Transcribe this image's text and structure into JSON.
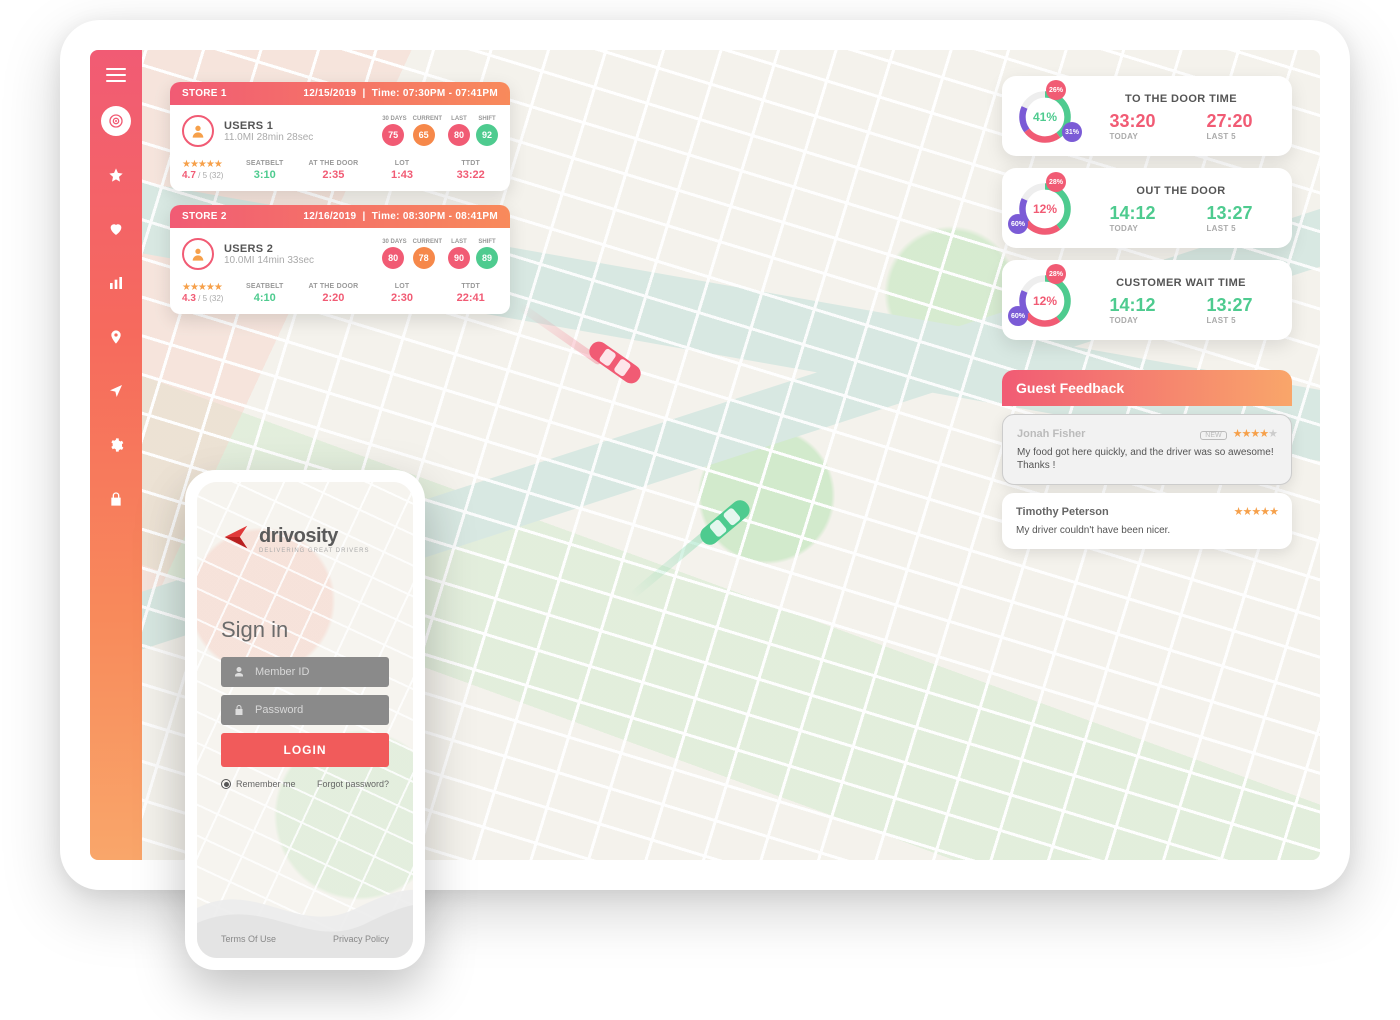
{
  "brand": {
    "name": "drivosity",
    "tagline": "DELIVERING GREAT DRIVERS"
  },
  "colors": {
    "pink": "#f15b74",
    "orange": "#f88a5b",
    "green": "#4ecb8f",
    "purple": "#7b5bd6"
  },
  "sidebar": {
    "items": [
      "menu",
      "target",
      "star",
      "heart",
      "chart",
      "pin",
      "nav",
      "gear",
      "lock"
    ],
    "active_index": 1
  },
  "store_cards": [
    {
      "store": "STORE 1",
      "date": "12/15/2019",
      "time_range": "Time: 07:30PM - 07:41PM",
      "user_name": "USERS 1",
      "user_detail": "11.0MI 28min 28sec",
      "scores": [
        {
          "label": "30 DAYS",
          "value": "75",
          "color": "pill-red"
        },
        {
          "label": "CURRENT",
          "value": "65",
          "color": "pill-orange"
        },
        {
          "label": "LAST",
          "value": "80",
          "color": "pill-red"
        },
        {
          "label": "SHIFT",
          "value": "92",
          "color": "pill-green"
        }
      ],
      "stars": "★★★★★",
      "rating": "4.7",
      "rating_of": " / 5",
      "rating_count": "(32)",
      "metrics": [
        {
          "label": "SEATBELT",
          "value": "3:10",
          "cls": "mgreen"
        },
        {
          "label": "AT THE DOOR",
          "value": "2:35",
          "cls": "mred"
        },
        {
          "label": "LOT",
          "value": "1:43",
          "cls": "mred"
        },
        {
          "label": "TTDT",
          "value": "33:22",
          "cls": "mred"
        }
      ]
    },
    {
      "store": "STORE 2",
      "date": "12/16/2019",
      "time_range": "Time: 08:30PM - 08:41PM",
      "user_name": "USERS 2",
      "user_detail": "10.0MI 14min 33sec",
      "scores": [
        {
          "label": "30 DAYS",
          "value": "80",
          "color": "pill-red"
        },
        {
          "label": "CURRENT",
          "value": "78",
          "color": "pill-orange"
        },
        {
          "label": "LAST",
          "value": "90",
          "color": "pill-red"
        },
        {
          "label": "SHIFT",
          "value": "89",
          "color": "pill-green"
        }
      ],
      "stars": "★★★★★",
      "rating": "4.3",
      "rating_of": " / 5",
      "rating_count": "(32)",
      "metrics": [
        {
          "label": "SEATBELT",
          "value": "4:10",
          "cls": "mgreen"
        },
        {
          "label": "AT THE DOOR",
          "value": "2:20",
          "cls": "mred"
        },
        {
          "label": "LOT",
          "value": "2:30",
          "cls": "mred"
        },
        {
          "label": "TTDT",
          "value": "22:41",
          "cls": "mred"
        }
      ]
    }
  ],
  "stat_cards": [
    {
      "title": "TO THE DOOR TIME",
      "center": "41%",
      "center_color": "#4ecb8f",
      "bubble_top": "26%",
      "bubble_side": "31%",
      "today": "33:20",
      "last5": "27:20",
      "value_color": "#f15b74"
    },
    {
      "title": "OUT THE DOOR",
      "center": "12%",
      "center_color": "#f15b74",
      "bubble_top": "28%",
      "bubble_side": "60%",
      "today": "14:12",
      "last5": "13:27",
      "value_color": "#4ecb8f"
    },
    {
      "title": "CUSTOMER WAIT TIME",
      "center": "12%",
      "center_color": "#f15b74",
      "bubble_top": "28%",
      "bubble_side": "60%",
      "today": "14:12",
      "last5": "13:27",
      "value_color": "#4ecb8f"
    }
  ],
  "stat_labels": {
    "today": "TODAY",
    "last5": "LAST 5"
  },
  "feedback": {
    "title": "Guest Feedback",
    "items": [
      {
        "name": "Jonah Fisher",
        "new": true,
        "stars": 4,
        "body": "My food got here quickly, and the driver was so awesome! Thanks !",
        "selected": true
      },
      {
        "name": "Timothy Peterson",
        "new": false,
        "stars": 5,
        "body": "My driver couldn't have been nicer.",
        "selected": false
      }
    ],
    "new_label": "NEW"
  },
  "phone": {
    "signin_title": "Sign in",
    "member_placeholder": "Member ID",
    "password_placeholder": "Password",
    "login_label": "LOGIN",
    "remember_label": "Remember me",
    "forgot_label": "Forgot password?",
    "terms": "Terms Of Use",
    "privacy": "Privacy Policy"
  }
}
